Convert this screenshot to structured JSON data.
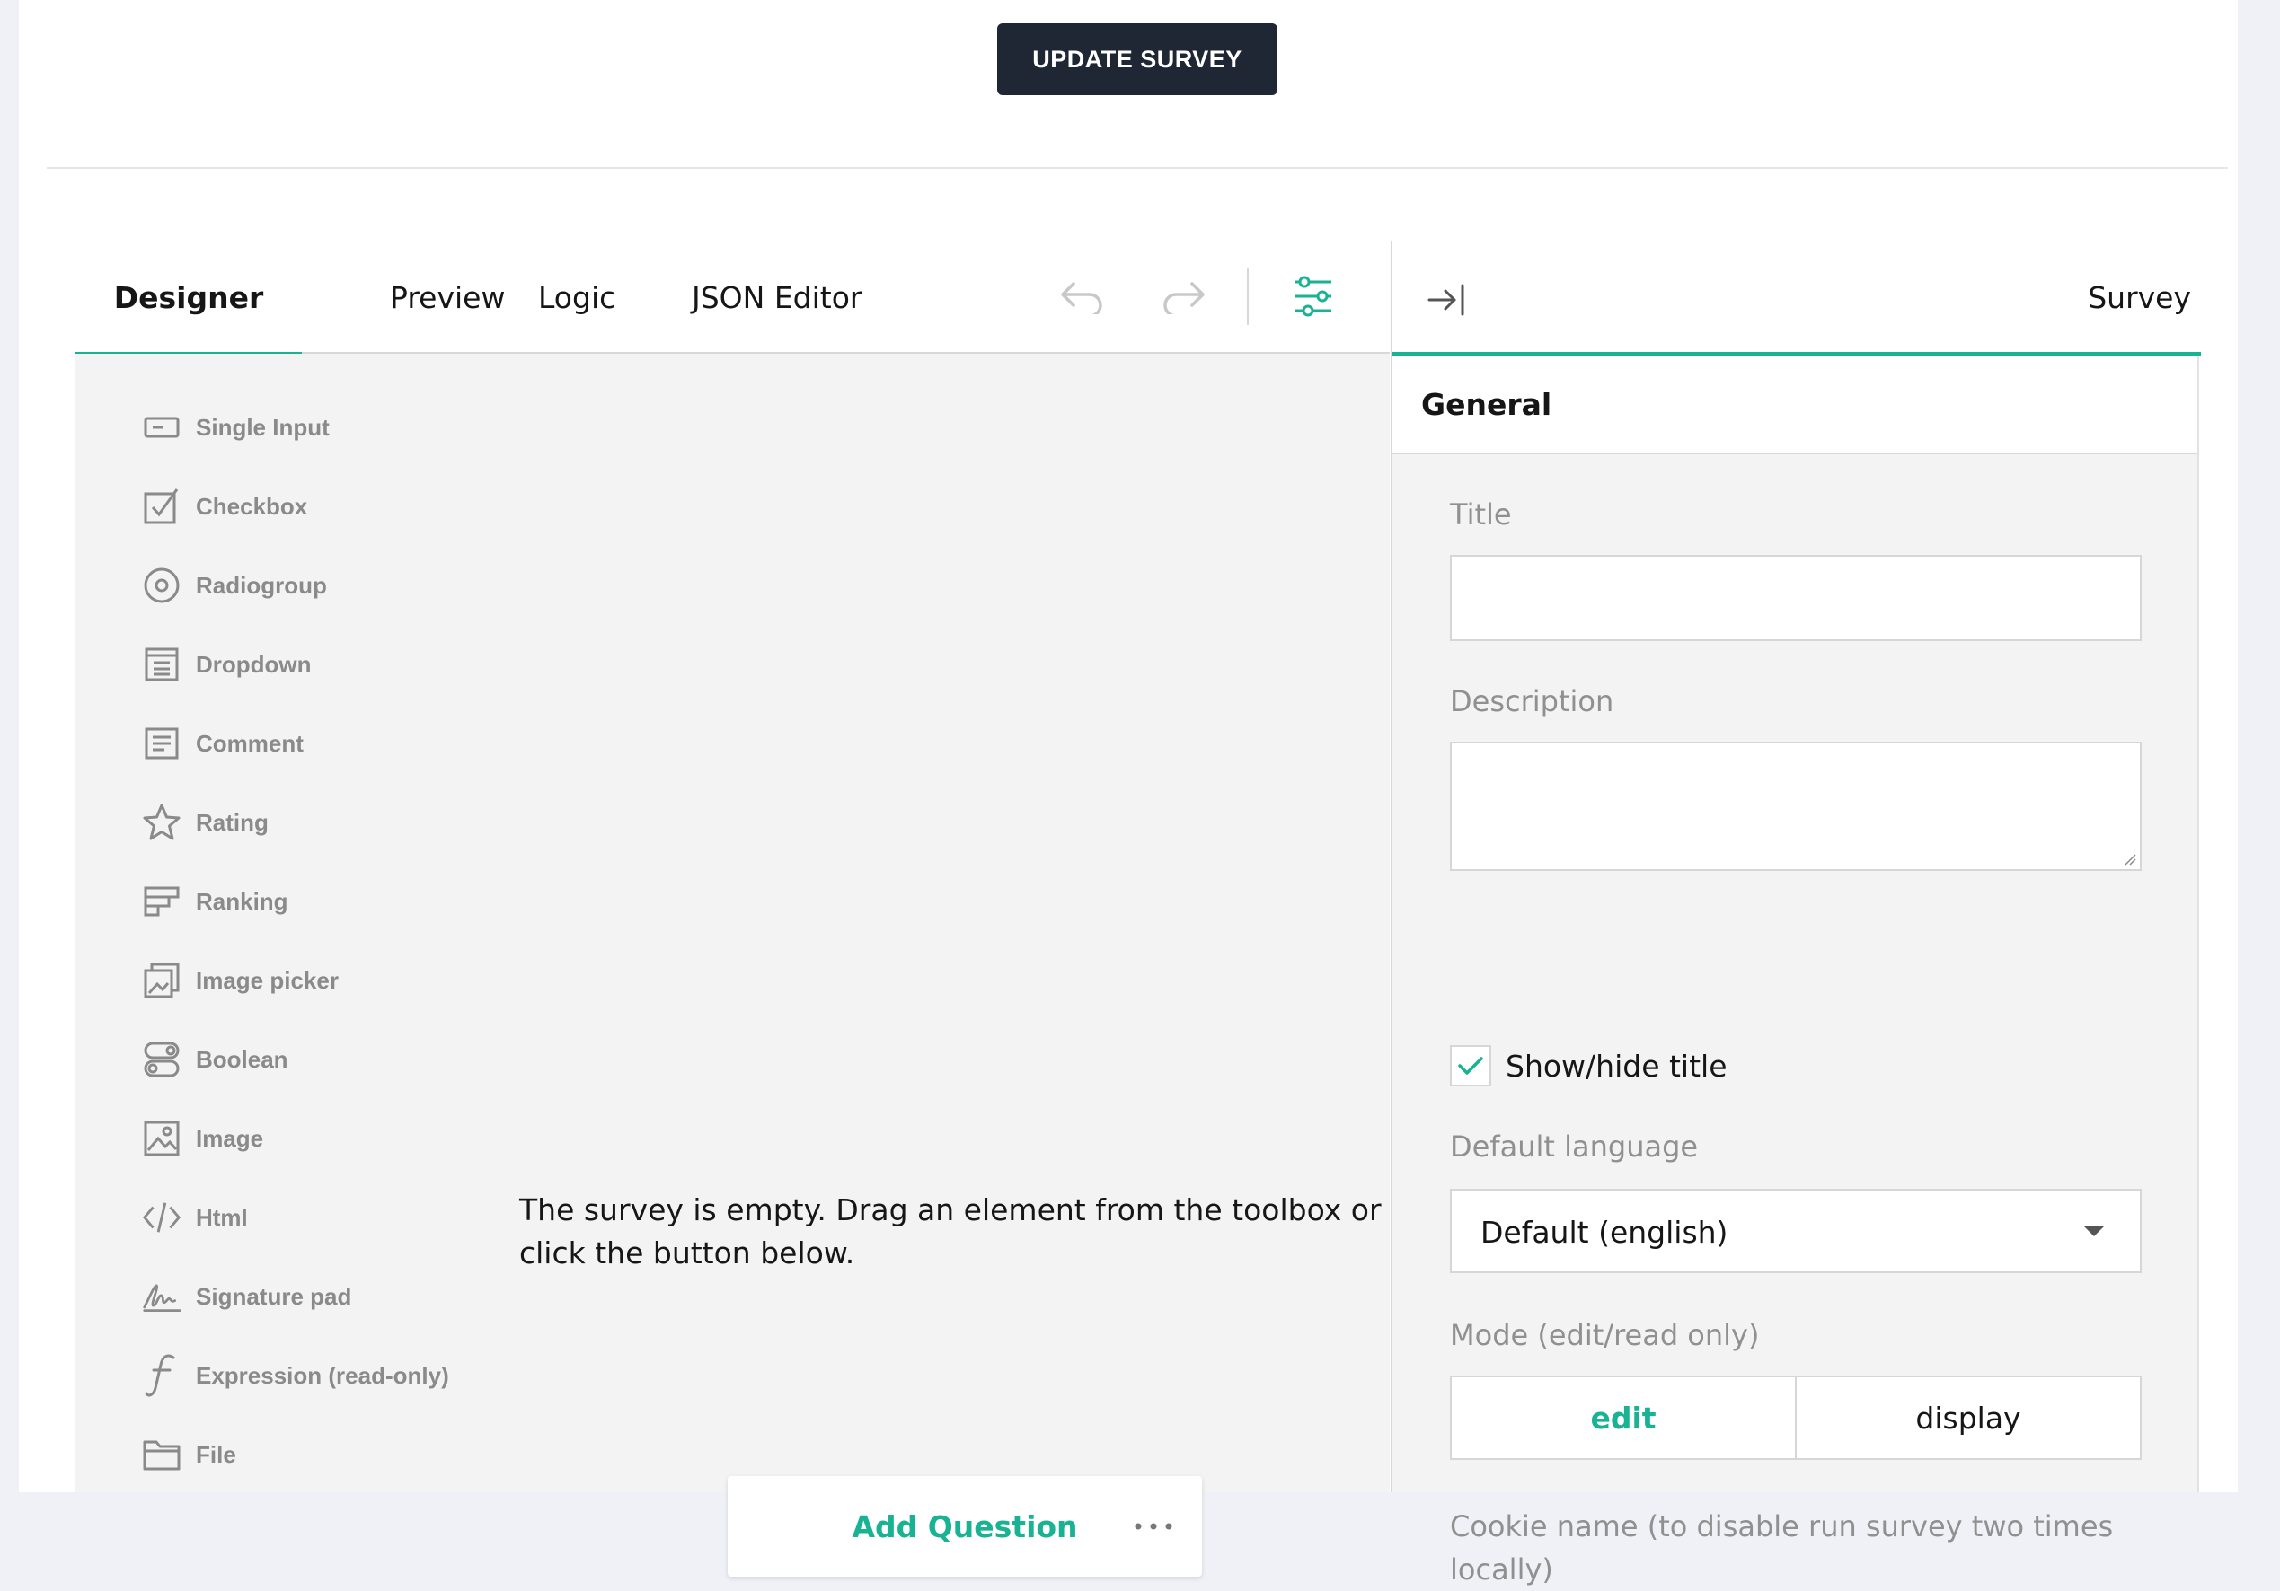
{
  "header": {
    "update_button": "UPDATE SURVEY"
  },
  "tabs": [
    {
      "label": "Designer",
      "active": true
    },
    {
      "label": "Preview",
      "active": false
    },
    {
      "label": "Logic",
      "active": false
    },
    {
      "label": "JSON Editor",
      "active": false
    }
  ],
  "toolbar_icons": [
    "undo-icon",
    "redo-icon",
    "settings-sliders-icon"
  ],
  "toolbox": [
    {
      "label": "Single Input",
      "icon": "single-input-icon"
    },
    {
      "label": "Checkbox",
      "icon": "checkbox-icon"
    },
    {
      "label": "Radiogroup",
      "icon": "radiogroup-icon"
    },
    {
      "label": "Dropdown",
      "icon": "dropdown-icon"
    },
    {
      "label": "Comment",
      "icon": "comment-icon"
    },
    {
      "label": "Rating",
      "icon": "star-icon"
    },
    {
      "label": "Ranking",
      "icon": "ranking-icon"
    },
    {
      "label": "Image picker",
      "icon": "image-picker-icon"
    },
    {
      "label": "Boolean",
      "icon": "boolean-icon"
    },
    {
      "label": "Image",
      "icon": "image-icon"
    },
    {
      "label": "Html",
      "icon": "code-icon"
    },
    {
      "label": "Signature pad",
      "icon": "signature-icon"
    },
    {
      "label": "Expression (read-only)",
      "icon": "expression-icon"
    },
    {
      "label": "File",
      "icon": "folder-icon"
    }
  ],
  "canvas": {
    "empty_text": "The survey is empty. Drag an element from the toolbox or click the button below.",
    "add_question": "Add Question"
  },
  "props": {
    "object_name": "Survey",
    "category": "General",
    "title_label": "Title",
    "title_value": "",
    "description_label": "Description",
    "description_value": "",
    "show_title_label": "Show/hide title",
    "show_title_checked": true,
    "default_language_label": "Default language",
    "default_language_value": "Default (english)",
    "mode_label": "Mode (edit/read only)",
    "mode_options": [
      "edit",
      "display"
    ],
    "mode_selected": "edit",
    "cookie_label": "Cookie name (to disable run survey two times locally)"
  },
  "colors": {
    "accent": "#19b394",
    "dark_button": "#1f2634",
    "canvas_bg": "#f3f3f3"
  }
}
